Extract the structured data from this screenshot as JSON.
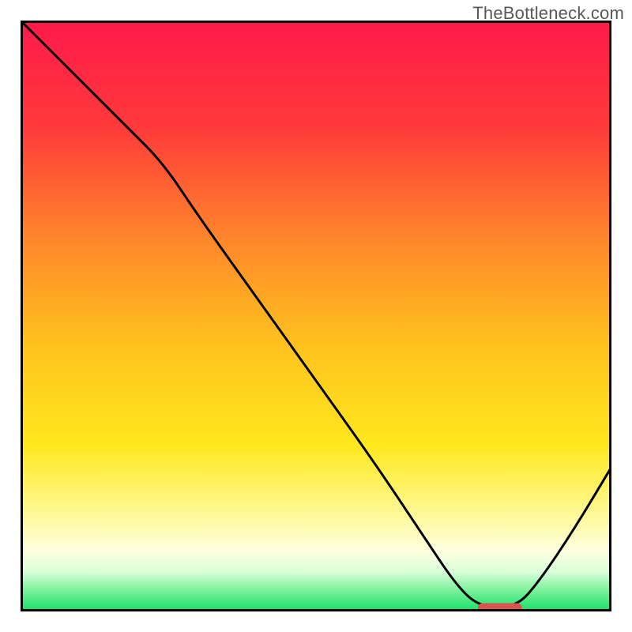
{
  "watermark": "TheBottleneck.com",
  "chart_data": {
    "type": "line",
    "title": "",
    "xlabel": "",
    "ylabel": "",
    "xlim": [
      0,
      100
    ],
    "ylim": [
      0,
      100
    ],
    "background_gradient": {
      "stops": [
        {
          "offset": 0.0,
          "color": "#ff1a4b"
        },
        {
          "offset": 0.18,
          "color": "#ff3a3a"
        },
        {
          "offset": 0.38,
          "color": "#ff8a2a"
        },
        {
          "offset": 0.55,
          "color": "#ffc21e"
        },
        {
          "offset": 0.72,
          "color": "#ffe81e"
        },
        {
          "offset": 0.84,
          "color": "#fff99a"
        },
        {
          "offset": 0.9,
          "color": "#fdffe0"
        },
        {
          "offset": 0.935,
          "color": "#d9ffd9"
        },
        {
          "offset": 0.965,
          "color": "#7ef29c"
        },
        {
          "offset": 1.0,
          "color": "#19e06a"
        }
      ]
    },
    "curve": {
      "comment": "black bottleneck curve; y=100 at x=0 descending to 0 near x≈78-84 then rising",
      "points": [
        {
          "x": 0.0,
          "y": 100.0
        },
        {
          "x": 10.0,
          "y": 90.0
        },
        {
          "x": 18.0,
          "y": 82.0
        },
        {
          "x": 24.0,
          "y": 76.0
        },
        {
          "x": 30.0,
          "y": 67.0
        },
        {
          "x": 40.0,
          "y": 53.0
        },
        {
          "x": 50.0,
          "y": 39.0
        },
        {
          "x": 60.0,
          "y": 25.0
        },
        {
          "x": 68.0,
          "y": 13.0
        },
        {
          "x": 74.0,
          "y": 4.0
        },
        {
          "x": 78.0,
          "y": 0.5
        },
        {
          "x": 84.0,
          "y": 0.5
        },
        {
          "x": 88.0,
          "y": 5.0
        },
        {
          "x": 94.0,
          "y": 14.0
        },
        {
          "x": 100.0,
          "y": 24.0
        }
      ]
    },
    "optimal_marker": {
      "comment": "red rounded bar marking the optimal zone at the curve minimum",
      "x_start": 77.5,
      "x_end": 85.0,
      "y": 0.0,
      "color": "#d9534f"
    },
    "frame_color": "#000000",
    "curve_color": "#000000"
  }
}
